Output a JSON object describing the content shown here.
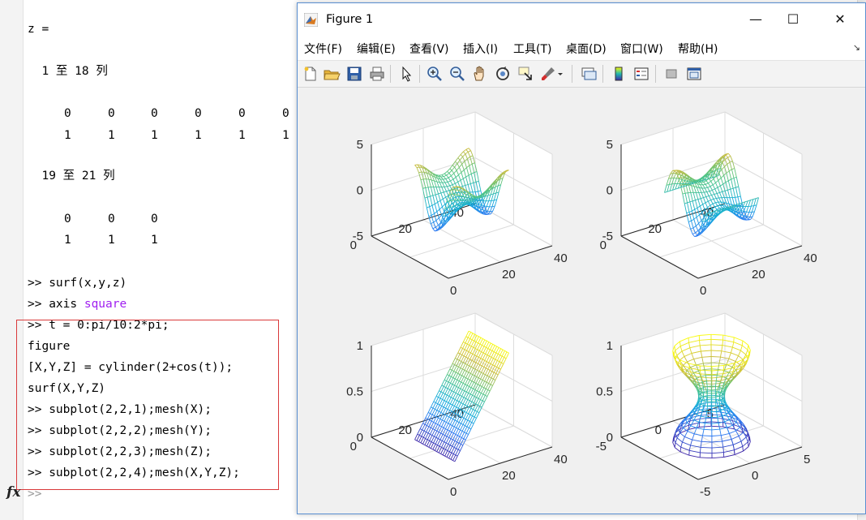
{
  "command_window": {
    "lines": [
      {
        "text": "z ="
      },
      {
        "text": "  1 至 18 列"
      },
      {
        "text": "  19 至 21 列"
      }
    ],
    "matrix1_row1": [
      "0",
      "0",
      "0",
      "0",
      "0",
      "0"
    ],
    "matrix1_row2": [
      "1",
      "1",
      "1",
      "1",
      "1",
      "1"
    ],
    "matrix2_row1": [
      "0",
      "0",
      "0"
    ],
    "matrix2_row2": [
      "1",
      "1",
      "1"
    ],
    "cmd_surf": ">> surf(x,y,z)",
    "cmd_axis_prefix": ">> axis ",
    "cmd_axis_arg": "square",
    "cmd_t": ">> t = 0:pi/10:2*pi;",
    "cmd_figure": "figure",
    "cmd_cylinder": "[X,Y,Z] = cylinder(2+cos(t));",
    "cmd_surfXYZ": "surf(X,Y,Z)",
    "cmd_sub1": ">> subplot(2,2,1);mesh(X);",
    "cmd_sub2": ">> subplot(2,2,2);mesh(Y);",
    "cmd_sub3": ">> subplot(2,2,3);mesh(Z);",
    "cmd_sub4": ">> subplot(2,2,4);mesh(X,Y,Z);",
    "prompt": ">>",
    "fx_label": "fx"
  },
  "figure_window": {
    "title": "Figure 1",
    "controls": {
      "minimize": "—",
      "maximize": "☐",
      "close": "✕"
    },
    "menu": [
      "文件(F)",
      "编辑(E)",
      "查看(V)",
      "插入(I)",
      "工具(T)",
      "桌面(D)",
      "窗口(W)",
      "帮助(H)"
    ],
    "menu_more": "↘",
    "toolbar_icons": [
      "new-figure-icon",
      "open-file-icon",
      "save-icon",
      "print-icon",
      "select-arrow-icon",
      "zoom-in-icon",
      "zoom-out-icon",
      "pan-hand-icon",
      "rotate3d-icon",
      "data-cursor-icon",
      "brush-icon",
      "link-plot-icon",
      "colorbar-icon",
      "legend-icon",
      "hide-tools-icon",
      "show-tools-icon"
    ]
  },
  "chart_data": [
    {
      "type": "mesh",
      "subplot": "2,2,1",
      "zticks": [
        "5",
        "0",
        "-5"
      ],
      "yticks": [
        "40",
        "20",
        "0"
      ],
      "xticks": [
        "0",
        "20",
        "40"
      ],
      "zlim": [
        -5,
        5
      ],
      "xlim": [
        0,
        40
      ],
      "ylim": [
        0,
        40
      ],
      "colormap": "parula"
    },
    {
      "type": "mesh",
      "subplot": "2,2,2",
      "zticks": [
        "5",
        "0",
        "-5"
      ],
      "yticks": [
        "40",
        "20",
        "0"
      ],
      "xticks": [
        "0",
        "20",
        "40"
      ],
      "zlim": [
        -5,
        5
      ],
      "xlim": [
        0,
        40
      ],
      "ylim": [
        0,
        40
      ],
      "colormap": "parula"
    },
    {
      "type": "mesh",
      "subplot": "2,2,3",
      "zticks": [
        "1",
        "0.5",
        "0"
      ],
      "yticks": [
        "40",
        "20",
        "0"
      ],
      "xticks": [
        "0",
        "20",
        "40"
      ],
      "zlim": [
        0,
        1
      ],
      "xlim": [
        0,
        40
      ],
      "ylim": [
        0,
        40
      ],
      "colormap": "parula"
    },
    {
      "type": "mesh",
      "subplot": "2,2,4",
      "zticks": [
        "1",
        "0.5",
        "0"
      ],
      "yticks": [
        "5",
        "0",
        "-5"
      ],
      "xticks": [
        "-5",
        "0",
        "5"
      ],
      "zlim": [
        0,
        1
      ],
      "xlim": [
        -5,
        5
      ],
      "ylim": [
        -5,
        5
      ],
      "colormap": "parula"
    }
  ]
}
